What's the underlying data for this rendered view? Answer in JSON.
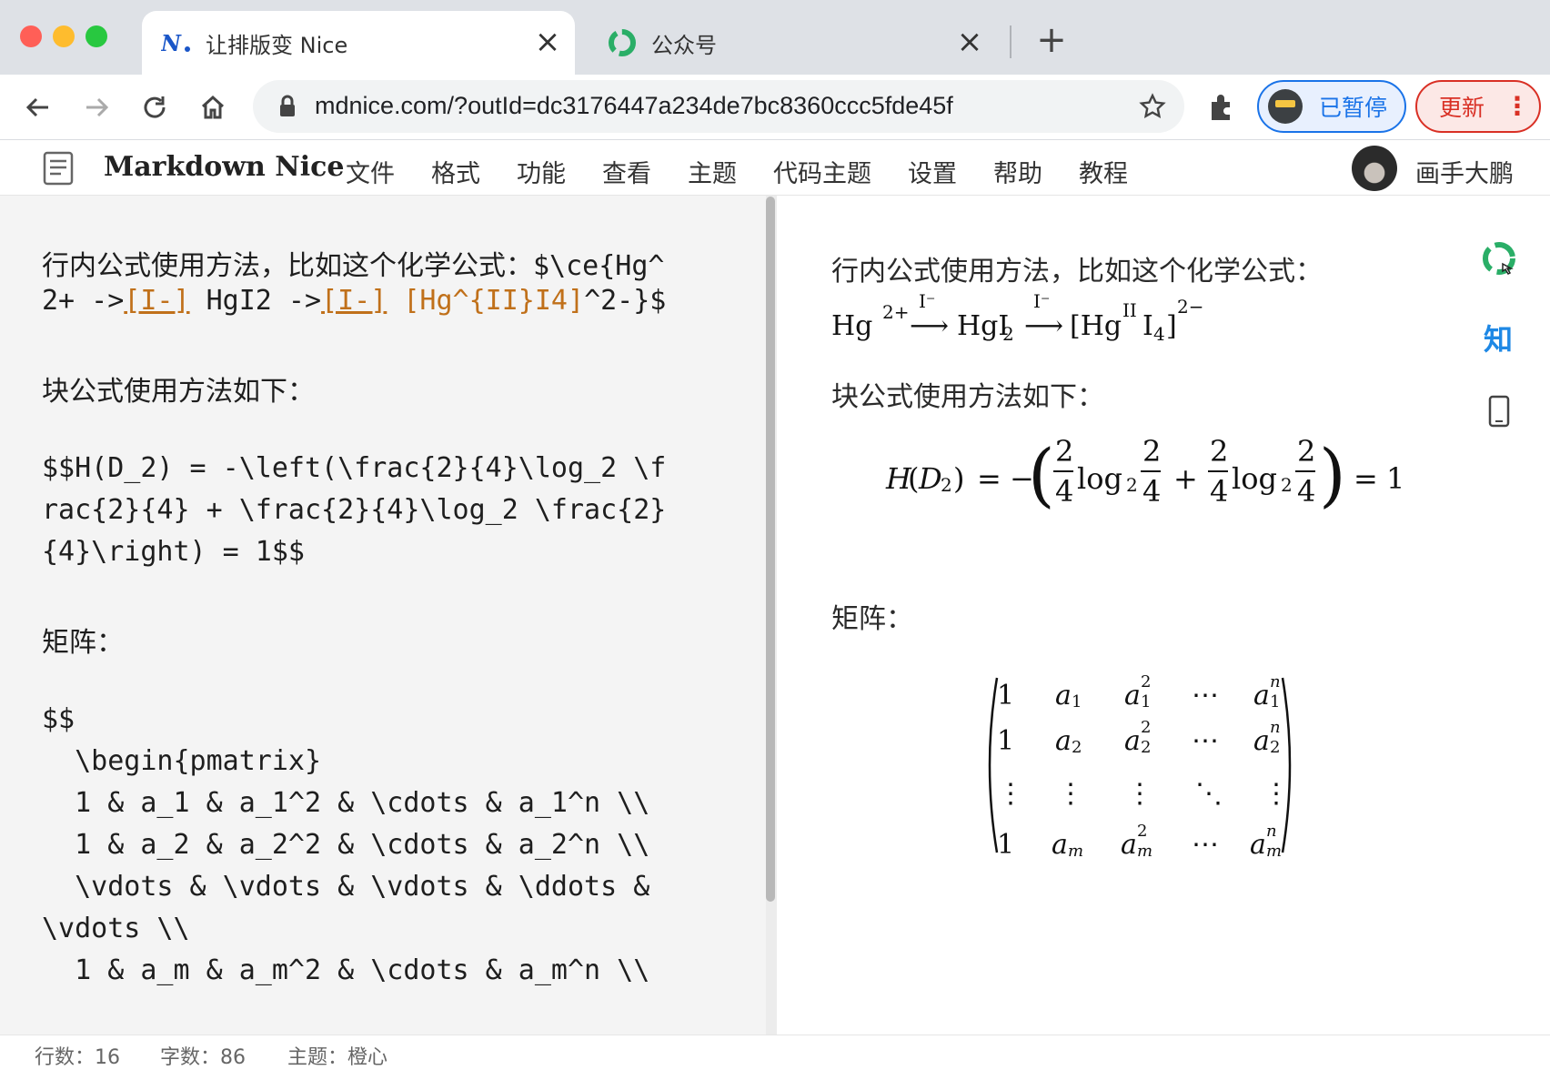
{
  "colors": {
    "close": "#ff5f57",
    "minimize": "#febc2e",
    "maximize": "#28c840",
    "accent_blue": "#1a73e8",
    "alert_red": "#d93025",
    "code_ref": "#c0701a",
    "zhihu_blue": "#1e88e5"
  },
  "tabs": [
    {
      "title": "让排版变 Nice",
      "icon": "mdnice-logo-icon",
      "active": true
    },
    {
      "title": "公众号",
      "icon": "wechat-green-icon",
      "active": false
    }
  ],
  "toolbar": {
    "url": "mdnice.com/?outId=dc3176447a234de7bc8360ccc5fde45f",
    "profile_label": "已暂停",
    "update_label": "更新",
    "update_menu": "⋮"
  },
  "app": {
    "name": "Markdown Nice",
    "menu": [
      "文件",
      "格式",
      "功能",
      "查看",
      "主题",
      "代码主题",
      "设置",
      "帮助",
      "教程"
    ],
    "user": "画手大鹏"
  },
  "editor": {
    "line1_pre": "行内公式使用方法，比如这个化学公式：",
    "line1_code": "$\\ce{Hg^",
    "line2_a": "2+ ->",
    "line2_ref1": "[I-]",
    "line2_b": " HgI2 ->",
    "line2_ref2": "[I-]",
    "line2_c": " ",
    "line2_orange": "[Hg^{II}I4]",
    "line2_d": "^2-}$",
    "block_heading": "块公式使用方法如下：",
    "block_lines": [
      "$$H(D_2) = -\\left(\\frac{2}{4}\\log_2 \\f",
      "rac{2}{4} + \\frac{2}{4}\\log_2 \\frac{2}",
      "{4}\\right) = 1$$"
    ],
    "matrix_heading": "矩阵：",
    "matrix_lines": [
      "$$",
      "  \\begin{pmatrix}",
      "  1 & a_1 & a_1^2 & \\cdots & a_1^n \\\\",
      "  1 & a_2 & a_2^2 & \\cdots & a_2^n \\\\",
      "  \\vdots & \\vdots & \\vdots & \\ddots &",
      "\\vdots \\\\",
      "  1 & a_m & a_m^2 & \\cdots & a_m^n \\\\"
    ]
  },
  "preview": {
    "inline_heading": "行内公式使用方法，比如这个化学公式：",
    "chem": {
      "hg": "Hg",
      "hg_sup": "2+",
      "arrow_label": "I⁻",
      "hgi": "HgI",
      "hgi_sub": "2",
      "complex_open": "[Hg",
      "complex_sup": "II",
      "complex_i": "I",
      "complex_sub": "4",
      "complex_close": "]",
      "complex_charge": "2−"
    },
    "block_heading": "块公式使用方法如下：",
    "formula": {
      "lhs": "H",
      "lhs_arg": "D",
      "lhs_sub": "2",
      "eq": "=",
      "minus": "−",
      "num": "2",
      "den": "4",
      "log": "log",
      "log_sub": "2",
      "plus": "+",
      "result": "1"
    },
    "matrix_heading": "矩阵：",
    "matrix": {
      "rows": [
        [
          "1",
          "a",
          "a",
          "⋯",
          "a"
        ],
        [
          "1",
          "a",
          "a",
          "⋯",
          "a"
        ],
        [
          "⋮",
          "⋮",
          "⋮",
          "⋱",
          "⋮"
        ],
        [
          "1",
          "a",
          "a",
          "⋯",
          "a"
        ]
      ],
      "subs": [
        [
          "",
          "1",
          "1",
          "",
          "1"
        ],
        [
          "",
          "2",
          "2",
          "",
          "2"
        ],
        [
          "",
          "",
          "",
          "",
          ""
        ],
        [
          "",
          "m",
          "m",
          "",
          "m"
        ]
      ],
      "sups": [
        [
          "",
          "",
          "2",
          "",
          "n"
        ],
        [
          "",
          "",
          "2",
          "",
          "n"
        ],
        [
          "",
          "",
          "",
          "",
          ""
        ],
        [
          "",
          "",
          "2",
          "",
          "n"
        ]
      ]
    },
    "zhihu_label": "知"
  },
  "status": {
    "lines": "行数：16",
    "chars": "字数：86",
    "theme": "主题：橙心"
  }
}
